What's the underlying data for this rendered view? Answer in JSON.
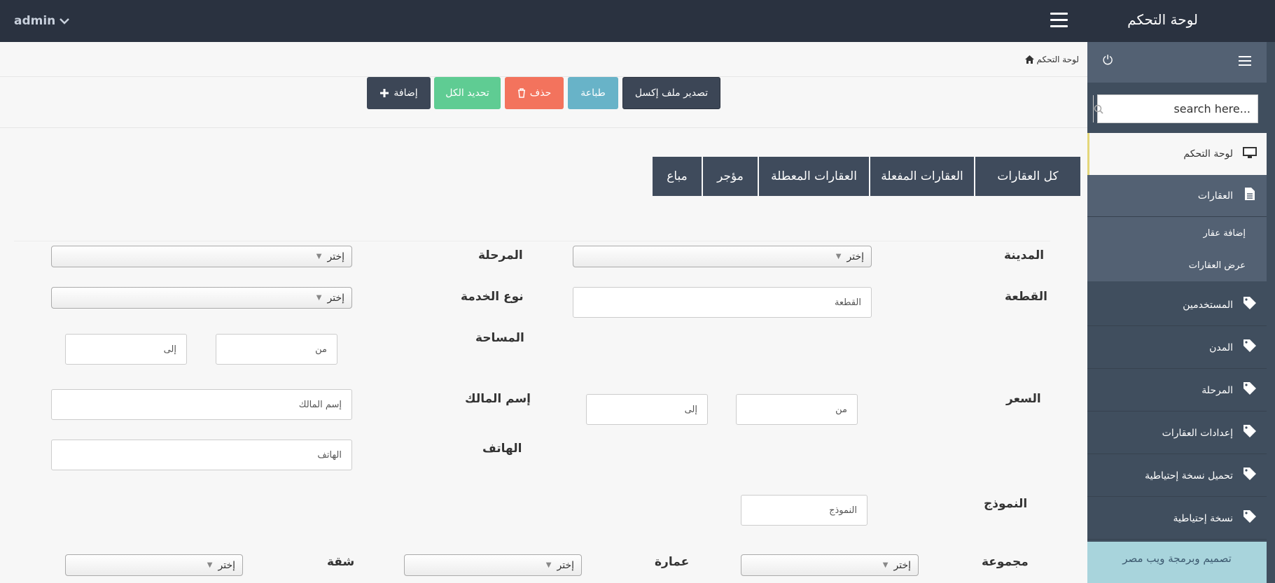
{
  "header": {
    "user": "admin",
    "brand": "لوحة التحكم"
  },
  "sidebar": {
    "search_placeholder": "search here...",
    "items": [
      {
        "label": "لوحة التحكم"
      },
      {
        "label": "العقارات"
      },
      {
        "label": "المستخدمين"
      },
      {
        "label": "المدن"
      },
      {
        "label": "المرحلة"
      },
      {
        "label": "إعدادات العقارات"
      },
      {
        "label": "تحميل نسخة إحتياطية"
      },
      {
        "label": "نسخة إحتياطية"
      }
    ],
    "sub_items": [
      {
        "label": "إضافة عقار"
      },
      {
        "label": "عرض العقارات"
      }
    ],
    "footer": "تصميم وبرمجة ويب مصر"
  },
  "breadcrumb": "لوحة التحكم",
  "toolbar": {
    "export_excel": "تصدير ملف إكسل",
    "print": "طباعة",
    "delete": "حذف",
    "select_all": "تحديد الكل",
    "add": "إضافة"
  },
  "tabs": [
    "كل العقارات",
    "العقارات المفعلة",
    "العقارات المعطلة",
    "مؤجر",
    "مباع"
  ],
  "filters": {
    "city_label": "المدينة",
    "phase_label": "المرحلة",
    "plot_label": "القطعة",
    "service_label": "نوع الخدمة",
    "area_label": "المساحة",
    "price_label": "السعر",
    "owner_label": "إسم المالك",
    "phone_label": "الهاتف",
    "model_label": "النموذج",
    "group_label": "مجموعة",
    "building_label": "عمارة",
    "apartment_label": "شقة",
    "choose": "إختر",
    "plot_placeholder": "القطعة",
    "from_placeholder": "من",
    "to_placeholder": "إلى",
    "owner_placeholder": "إسم المالك",
    "phone_placeholder": "الهاتف",
    "model_placeholder": "النموذج"
  }
}
